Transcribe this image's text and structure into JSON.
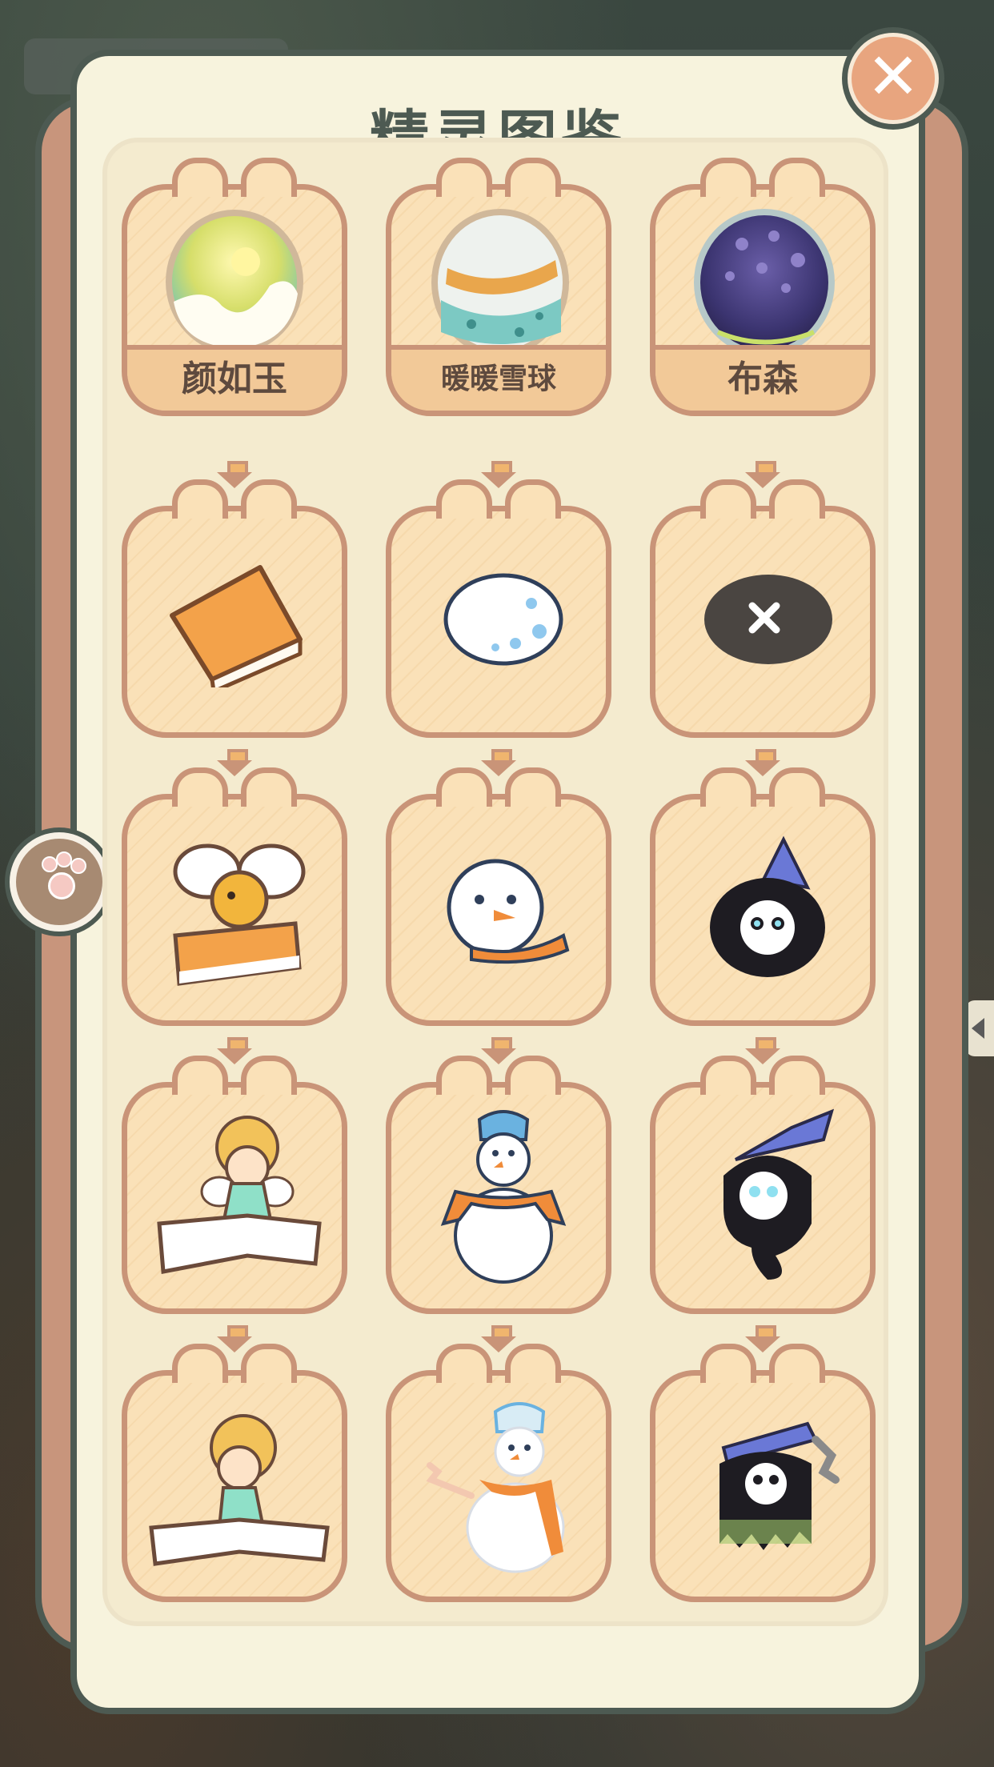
{
  "title": "精灵图鉴",
  "close_label": "✕",
  "eggs": [
    {
      "name": "颜如玉",
      "icon": "green-yellow-egg-icon"
    },
    {
      "name": "暖暖雪球",
      "icon": "snow-egg-with-scarf-icon"
    },
    {
      "name": "布森",
      "icon": "purple-galaxy-egg-icon"
    }
  ],
  "stages": [
    [
      "closed-book-icon",
      "white-egg-icon",
      "dark-stone-icon"
    ],
    [
      "winged-book-sprite-icon",
      "snowman-head-icon",
      "hooded-skull-ghost-icon"
    ],
    [
      "book-fairy-icon",
      "snowman-with-hat-icon",
      "witch-hat-ghost-icon"
    ],
    [
      "reading-elf-icon",
      "waving-snowman-icon",
      "tattered-reaper-icon"
    ]
  ],
  "colors": {
    "panel": "#f7f3dd",
    "outline": "#4d5a52",
    "cell": "#fae1b8",
    "cell_border": "#c99478",
    "close": "#e8a57f"
  }
}
